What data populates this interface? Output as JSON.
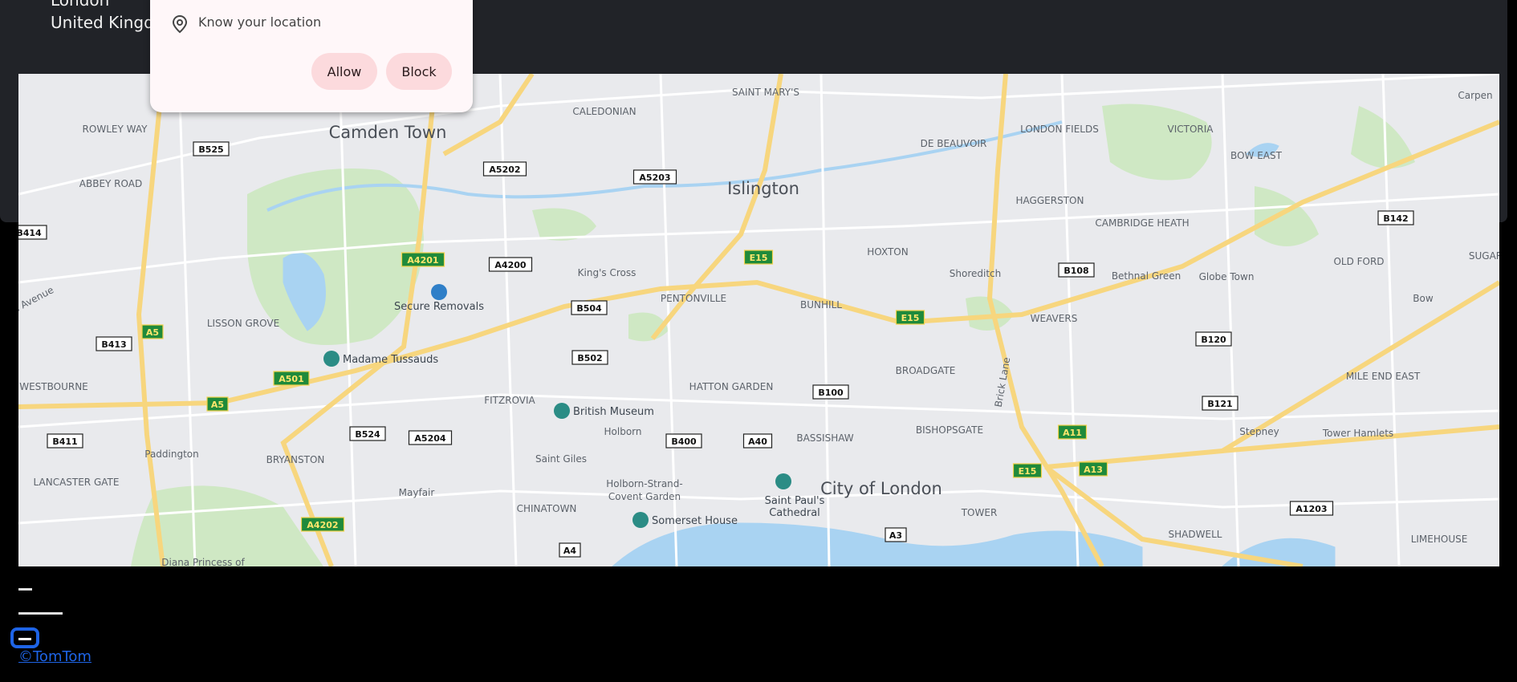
{
  "header": {
    "city": "London",
    "country": "United Kingdom"
  },
  "permission_popup": {
    "message": "Know your location",
    "allow_label": "Allow",
    "block_label": "Block"
  },
  "map": {
    "districts": [
      {
        "name": "Camden Town",
        "size": "large"
      },
      {
        "name": "Islington",
        "size": "large"
      },
      {
        "name": "City of London",
        "size": "large"
      },
      {
        "name": "SAINT MARY'S",
        "size": "small"
      },
      {
        "name": "CALEDONIAN",
        "size": "small"
      },
      {
        "name": "ROWLEY WAY",
        "size": "small"
      },
      {
        "name": "ABBEY ROAD",
        "size": "small"
      },
      {
        "name": "DE BEAUVOIR",
        "size": "small"
      },
      {
        "name": "LONDON FIELDS",
        "size": "small"
      },
      {
        "name": "VICTORIA",
        "size": "small"
      },
      {
        "name": "BOW EAST",
        "size": "small"
      },
      {
        "name": "Carpen",
        "size": "small"
      },
      {
        "name": "HAGGERSTON",
        "size": "small"
      },
      {
        "name": "CAMBRIDGE HEATH",
        "size": "small"
      },
      {
        "name": "SUGAR",
        "size": "small"
      },
      {
        "name": "HOXTON",
        "size": "small"
      },
      {
        "name": "Shoreditch",
        "size": "small"
      },
      {
        "name": "Bethnal Green",
        "size": "small"
      },
      {
        "name": "Globe Town",
        "size": "small"
      },
      {
        "name": "OLD FORD",
        "size": "small"
      },
      {
        "name": "Bow",
        "size": "small"
      },
      {
        "name": "King's Cross",
        "size": "small"
      },
      {
        "name": "PENTONVILLE",
        "size": "small"
      },
      {
        "name": "BUNHILL",
        "size": "small"
      },
      {
        "name": "WEAVERS",
        "size": "small"
      },
      {
        "name": "LISSON GROVE",
        "size": "small"
      },
      {
        "name": "BROADGATE",
        "size": "small"
      },
      {
        "name": "MILE END EAST",
        "size": "small"
      },
      {
        "name": "WESTBOURNE",
        "size": "small"
      },
      {
        "name": "FITZROVIA",
        "size": "small"
      },
      {
        "name": "HATTON GARDEN",
        "size": "small"
      },
      {
        "name": "Brick Lane",
        "size": "small"
      },
      {
        "name": "Holborn",
        "size": "small"
      },
      {
        "name": "BASSISHAW",
        "size": "small"
      },
      {
        "name": "BISHOPSGATE",
        "size": "small"
      },
      {
        "name": "Stepney",
        "size": "small"
      },
      {
        "name": "Tower Hamlets",
        "size": "small"
      },
      {
        "name": "Paddington",
        "size": "small"
      },
      {
        "name": "BRYANSTON",
        "size": "small"
      },
      {
        "name": "Saint Giles",
        "size": "small"
      },
      {
        "name": "LANCASTER GATE",
        "size": "small"
      },
      {
        "name": "Mayfair",
        "size": "small"
      },
      {
        "name": "Holborn-Strand-",
        "size": "small"
      },
      {
        "name": "Covent Garden",
        "size": "small"
      },
      {
        "name": "TOWER",
        "size": "small"
      },
      {
        "name": "SHADWELL",
        "size": "small"
      },
      {
        "name": "LIMEHOUSE",
        "size": "small"
      },
      {
        "name": "CHINATOWN",
        "size": "small"
      },
      {
        "name": "Diana Princess of",
        "size": "small"
      },
      {
        "name": "n Avenue",
        "size": "small"
      }
    ],
    "pois": [
      {
        "name": "Secure Removals",
        "icon": "removals-icon"
      },
      {
        "name": "Madame Tussauds",
        "icon": "camera-icon"
      },
      {
        "name": "British Museum",
        "icon": "camera-icon"
      },
      {
        "name": "Saint Paul's",
        "icon": "camera-icon"
      },
      {
        "name": "Cathedral",
        "icon": "none"
      },
      {
        "name": "Somerset House",
        "icon": "camera-icon"
      }
    ],
    "road_badges": [
      {
        "ref": "B525",
        "kind": "white"
      },
      {
        "ref": "A5202",
        "kind": "white"
      },
      {
        "ref": "A5203",
        "kind": "white"
      },
      {
        "ref": "B414",
        "kind": "white"
      },
      {
        "ref": "A4201",
        "kind": "green"
      },
      {
        "ref": "A4200",
        "kind": "white"
      },
      {
        "ref": "E15",
        "kind": "green"
      },
      {
        "ref": "B108",
        "kind": "white"
      },
      {
        "ref": "B142",
        "kind": "white"
      },
      {
        "ref": "A5",
        "kind": "green"
      },
      {
        "ref": "B413",
        "kind": "white"
      },
      {
        "ref": "B504",
        "kind": "white"
      },
      {
        "ref": "E15",
        "kind": "green"
      },
      {
        "ref": "B120",
        "kind": "white"
      },
      {
        "ref": "A501",
        "kind": "green"
      },
      {
        "ref": "B502",
        "kind": "white"
      },
      {
        "ref": "A5",
        "kind": "green"
      },
      {
        "ref": "B100",
        "kind": "white"
      },
      {
        "ref": "B121",
        "kind": "white"
      },
      {
        "ref": "B411",
        "kind": "white"
      },
      {
        "ref": "B524",
        "kind": "white"
      },
      {
        "ref": "A5204",
        "kind": "white"
      },
      {
        "ref": "B400",
        "kind": "white"
      },
      {
        "ref": "A40",
        "kind": "white"
      },
      {
        "ref": "A11",
        "kind": "green"
      },
      {
        "ref": "E15",
        "kind": "green"
      },
      {
        "ref": "A13",
        "kind": "green"
      },
      {
        "ref": "A1203",
        "kind": "white"
      },
      {
        "ref": "A4202",
        "kind": "green"
      },
      {
        "ref": "A3",
        "kind": "white"
      },
      {
        "ref": "A4",
        "kind": "white"
      }
    ],
    "colors": {
      "background": "#e9eaed",
      "park": "#cfe8c4",
      "water": "#a9d3f2",
      "major_road": "#f7d67e",
      "minor_road": "#ffffff",
      "badge_green": "#1f8a3b"
    }
  },
  "footer": {
    "copyright": "©TomTom",
    "logo_icon": "tomtom-logo-icon"
  }
}
